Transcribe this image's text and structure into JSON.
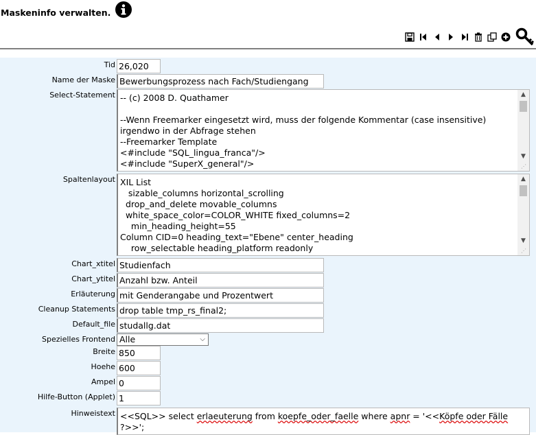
{
  "header": {
    "title": "Maskeninfo verwalten."
  },
  "icons": {
    "info": "info-icon",
    "toolbar": [
      "save-icon",
      "first-record-icon",
      "previous-record-icon",
      "next-record-icon",
      "last-record-icon",
      "delete-icon",
      "copy-icon",
      "add-icon"
    ],
    "search": "key-icon"
  },
  "colors": {
    "form_background": "#eaf4fc",
    "divider": "#7f7f7f"
  },
  "form": {
    "tid": {
      "label": "Tid",
      "value": "26,020"
    },
    "name": {
      "label": "Name der Maske",
      "value": "Bewerbungsprozess nach Fach/Studiengang"
    },
    "select_statement": {
      "label": "Select-Statement",
      "value": "-- (c) 2008 D. Quathamer\n\n--Wenn Freemarker eingesetzt wird, muss der folgende Kommentar (case insensitive) irgendwo in der Abfrage stehen\n--Freemarker Template\n<#include \"SQL_lingua_franca\"/>\n<#include \"SuperX_general\"/>"
    },
    "spaltenlayout": {
      "label": "Spaltenlayout",
      "value": "XIL List\n   sizable_columns horizontal_scrolling\n  drop_and_delete movable_columns\n  white_space_color=COLOR_WHITE fixed_columns=2\n    min_heading_height=55\nColumn CID=0 heading_text=\"Ebene\" center_heading\n    row_selectable heading_platform readonly"
    },
    "chart_xtitel": {
      "label": "Chart_xtitel",
      "value": "Studienfach"
    },
    "chart_ytitel": {
      "label": "Chart_ytitel",
      "value": "Anzahl bzw. Anteil"
    },
    "erlaeuterung": {
      "label": "Erläuterung",
      "value": "mit Genderangabe und Prozentwert"
    },
    "cleanup": {
      "label": "Cleanup Statements",
      "value": "drop table tmp_rs_final2;"
    },
    "default_file": {
      "label": "Default_file",
      "value": "studallg.dat"
    },
    "frontend": {
      "label": "Spezielles Frontend",
      "value": "Alle"
    },
    "breite": {
      "label": "Breite",
      "value": "850"
    },
    "hoehe": {
      "label": "Hoehe",
      "value": "600"
    },
    "ampel": {
      "label": "Ampel",
      "value": "0"
    },
    "hilfe_button": {
      "label": "Hilfe-Button (Applet)",
      "value": "1"
    },
    "hinweistext": {
      "label": "Hinweistext",
      "part1": "<<SQL>> select ",
      "word1": "erlaeuterung",
      "part2": " from ",
      "word2": "koepfe_oder_faelle",
      "part3": " where ",
      "word3": "apnr",
      "part4": " = '<<",
      "word4": "Köpfe oder Fälle",
      "part5": "\n?>>';"
    }
  }
}
